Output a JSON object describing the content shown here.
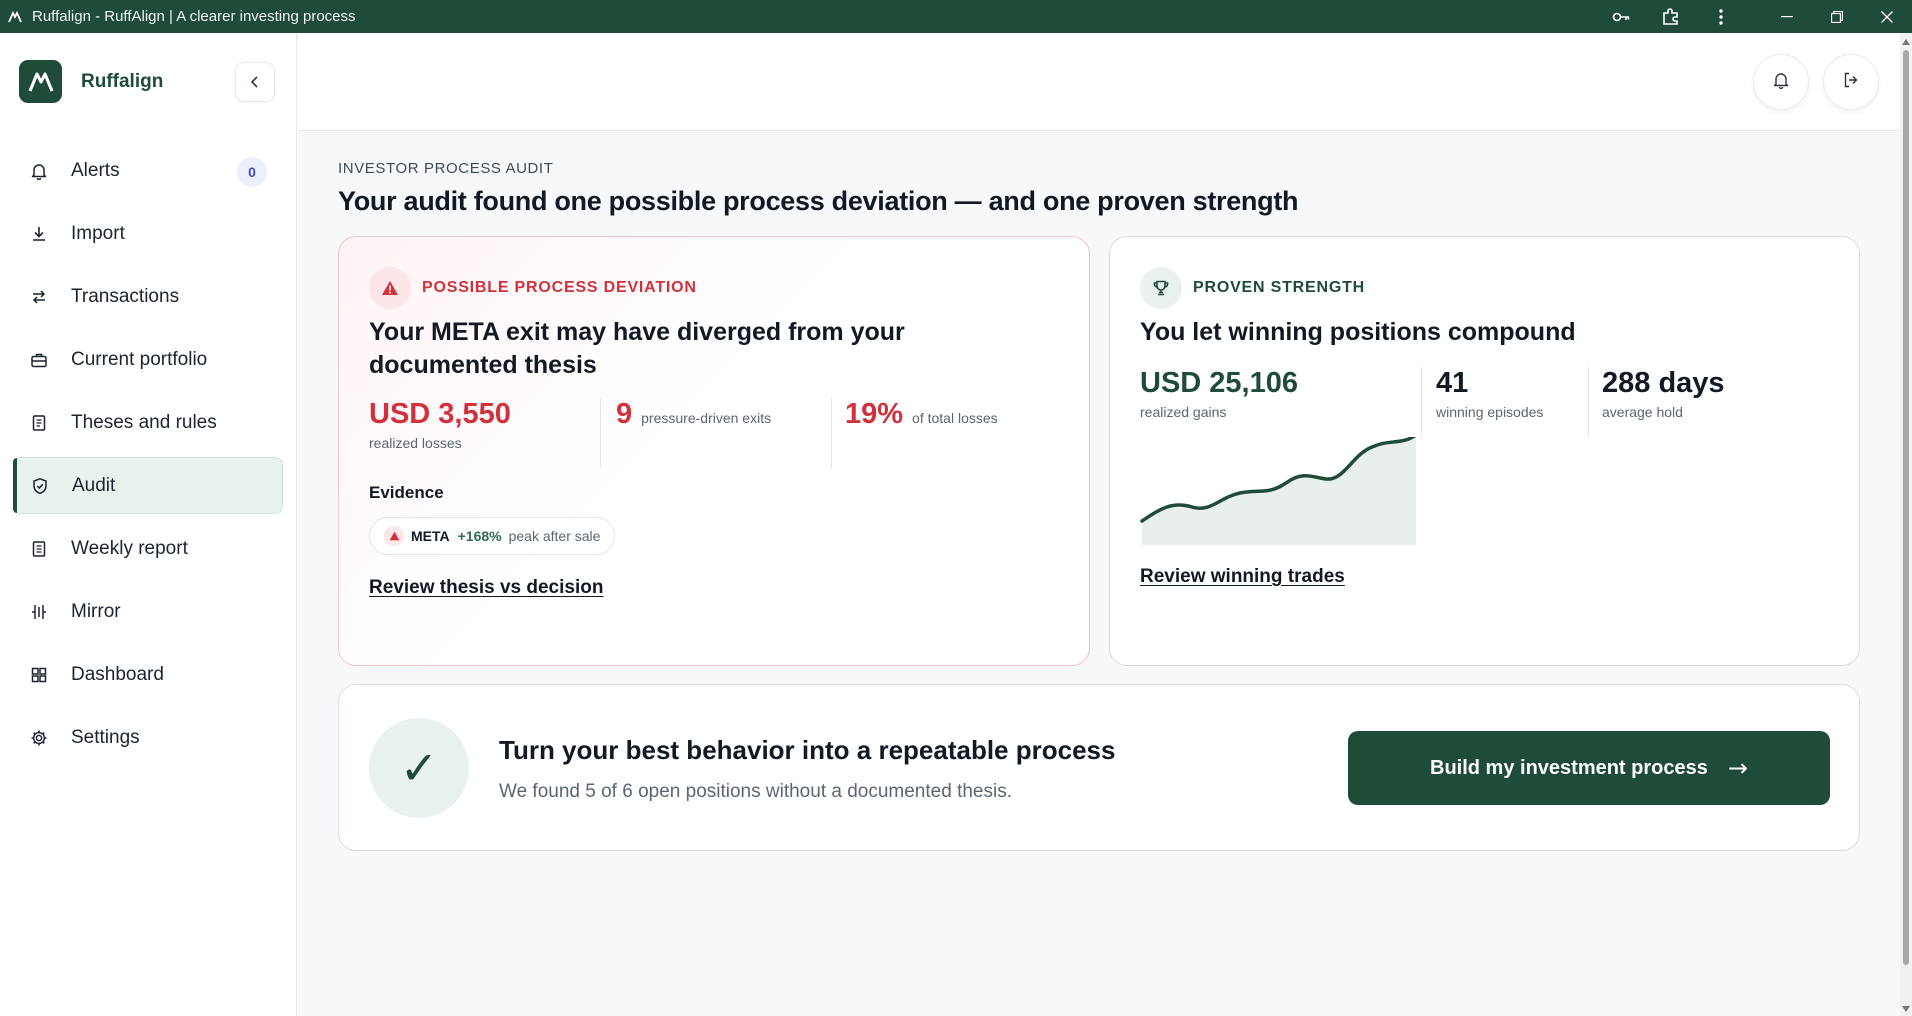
{
  "window": {
    "title": "Ruffalign - RuffAlign | A clearer investing process"
  },
  "brand": {
    "name": "Ruffalign"
  },
  "sidebar": {
    "items": [
      {
        "label": "Alerts",
        "icon": "bell-icon",
        "badge": "0"
      },
      {
        "label": "Import",
        "icon": "download-icon"
      },
      {
        "label": "Transactions",
        "icon": "swap-arrows-icon"
      },
      {
        "label": "Current portfolio",
        "icon": "briefcase-icon"
      },
      {
        "label": "Theses and rules",
        "icon": "document-icon"
      },
      {
        "label": "Audit",
        "icon": "shield-check-icon",
        "active": true
      },
      {
        "label": "Weekly report",
        "icon": "report-icon"
      },
      {
        "label": "Mirror",
        "icon": "mirror-icon"
      },
      {
        "label": "Dashboard",
        "icon": "grid-icon"
      },
      {
        "label": "Settings",
        "icon": "gear-icon"
      }
    ]
  },
  "main": {
    "eyebrow": "INVESTOR PROCESS AUDIT",
    "title": "Your audit found one possible process deviation — and one proven strength",
    "deviation": {
      "tag": "POSSIBLE PROCESS DEVIATION",
      "heading_line1": "Your META exit may have diverged from your",
      "heading_line2": "documented thesis",
      "metric1_value": "USD 3,550",
      "metric1_label": "realized losses",
      "metric2_value": "9",
      "metric2_label": "pressure-driven exits",
      "metric3_value": "19%",
      "metric3_label": "of total losses",
      "evidence_title": "Evidence",
      "chip_symbol": "META",
      "chip_change": "+168%",
      "chip_note": "peak after sale",
      "link": "Review thesis vs decision"
    },
    "strength": {
      "tag": "PROVEN STRENGTH",
      "heading": "You let winning positions compound",
      "metric1_value": "USD 25,106",
      "metric1_label": "realized gains",
      "metric2_value": "41",
      "metric2_label": "winning episodes",
      "metric3_value": "288 days",
      "metric3_label": "average hold",
      "link": "Review winning trades"
    },
    "process": {
      "title": "Turn your best behavior into a repeatable process",
      "subtitle": "We found 5 of 6 open positions without a documented thesis.",
      "cta": "Build my investment process",
      "cta_arrow": "→"
    }
  },
  "colors": {
    "brand": "#1f4b39",
    "danger": "#d0313d",
    "positive": "#2d6a4f"
  }
}
